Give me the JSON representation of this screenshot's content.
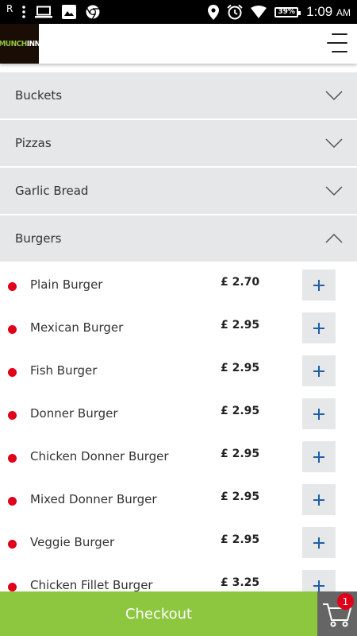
{
  "status_bar": {
    "carrier_indicator": "R",
    "battery_percent": "39%",
    "time": "1:09",
    "meridiem": "AM",
    "icons": [
      "signal-icon",
      "more-vert-icon",
      "laptop-icon",
      "image-icon",
      "chrome-icon",
      "location-icon",
      "alarm-icon",
      "wifi-icon",
      "battery-icon"
    ]
  },
  "header": {
    "logo_text_1": "MUNCH",
    "logo_text_2": "INN",
    "menu_icon": "hamburger-menu-icon"
  },
  "categories": [
    {
      "label": "Buckets",
      "expanded": false
    },
    {
      "label": "Pizzas",
      "expanded": false
    },
    {
      "label": "Garlic Bread",
      "expanded": false
    },
    {
      "label": "Burgers",
      "expanded": true
    }
  ],
  "items": [
    {
      "name": "Plain Burger",
      "price": "£ 2.70"
    },
    {
      "name": "Mexican Burger",
      "price": "£ 2.95"
    },
    {
      "name": "Fish Burger",
      "price": "£ 2.95"
    },
    {
      "name": "Donner Burger",
      "price": "£ 2.95"
    },
    {
      "name": "Chicken Donner Burger",
      "price": "£ 2.95"
    },
    {
      "name": "Mixed Donner Burger",
      "price": "£ 2.95"
    },
    {
      "name": "Veggie Burger",
      "price": "£ 2.95"
    },
    {
      "name": "Chicken Fillet Burger",
      "price": "£ 3.25"
    }
  ],
  "checkout": {
    "label": "Checkout",
    "cart_count": "1"
  },
  "colors": {
    "accent_green": "#8dc63f",
    "category_bg": "#e6e7e8",
    "item_dot": "#e0001a",
    "plus_blue": "#1f5fa6",
    "cart_bg": "#656565"
  }
}
